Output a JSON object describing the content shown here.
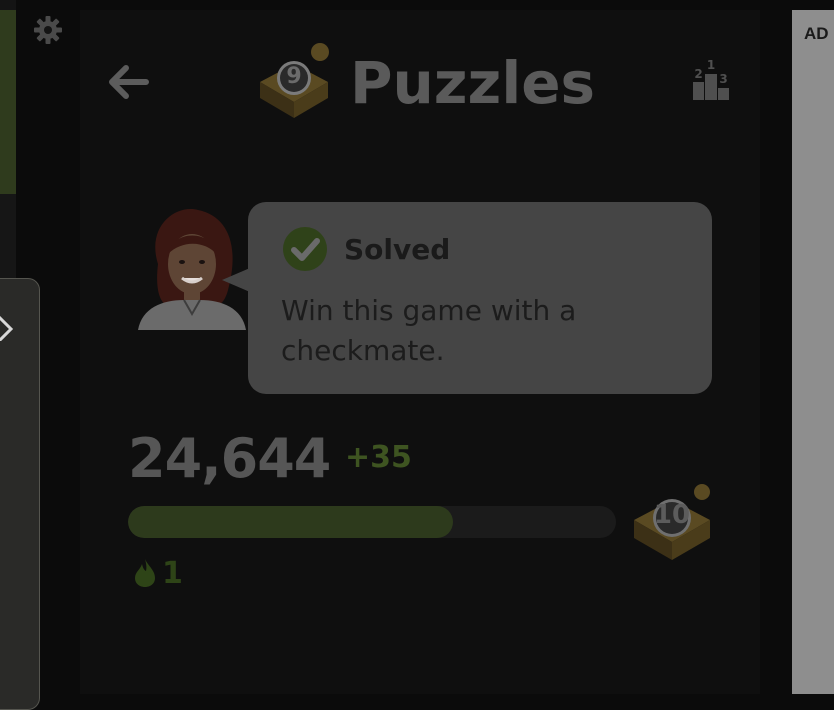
{
  "header": {
    "title": "Puzzles",
    "puzzle_badge_number": "9",
    "back_icon": "arrow-left-icon",
    "leaderboard_icon": "podium-icon",
    "leaderboard_digits": [
      "1",
      "2",
      "3"
    ]
  },
  "settings": {
    "icon": "gear-icon"
  },
  "coach": {
    "status": "Solved",
    "message": "Win this game with a checkmate.",
    "check_icon": "check-circle-icon"
  },
  "rating": {
    "value": "24,644",
    "delta": "+35",
    "progress": 0.667,
    "next_badge_number": "10"
  },
  "streak": {
    "icon": "flame-icon",
    "count": "1"
  },
  "ad": {
    "label": "AD"
  },
  "colors": {
    "background": "#0b0b0b",
    "panel": "#0f0f0f",
    "bubble": "#454545",
    "accent_green": "#3e5421",
    "progress_fill": "#2d3a1c"
  }
}
